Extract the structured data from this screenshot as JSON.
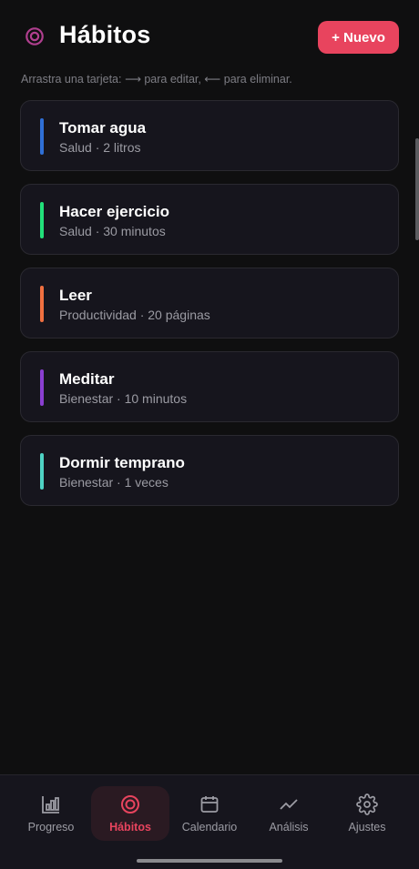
{
  "header": {
    "title": "Hábitos",
    "new_button": "+ Nuevo",
    "hint": "Arrastra una tarjeta: ⟶ para editar, ⟵ para eliminar."
  },
  "habits": [
    {
      "title": "Tomar agua",
      "subtitle": "Salud · 2 litros",
      "color": "#2f6fd6"
    },
    {
      "title": "Hacer ejercicio",
      "subtitle": "Salud · 30 minutos",
      "color": "#22e07a"
    },
    {
      "title": "Leer",
      "subtitle": "Productividad · 20 páginas",
      "color": "#f07040"
    },
    {
      "title": "Meditar",
      "subtitle": "Bienestar · 10 minutos",
      "color": "#8a3fd1"
    },
    {
      "title": "Dormir temprano",
      "subtitle": "Bienestar · 1 veces",
      "color": "#4fd3c4"
    }
  ],
  "nav": {
    "items": [
      {
        "label": "Progreso",
        "icon": "bar-chart-icon"
      },
      {
        "label": "Hábitos",
        "icon": "target-icon",
        "active": true
      },
      {
        "label": "Calendario",
        "icon": "calendar-icon"
      },
      {
        "label": "Análisis",
        "icon": "trend-icon"
      },
      {
        "label": "Ajustes",
        "icon": "gear-icon"
      }
    ]
  },
  "colors": {
    "accent": "#e8445e",
    "background": "#0f0f10",
    "card": "#16151d"
  }
}
